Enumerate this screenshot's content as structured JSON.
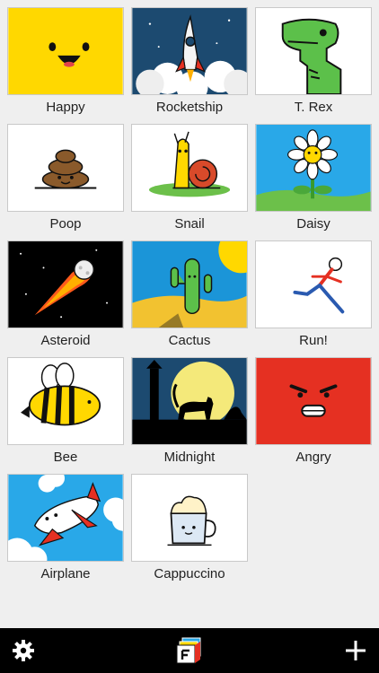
{
  "gallery": {
    "items": [
      {
        "label": "Happy",
        "bg": "#ffd800"
      },
      {
        "label": "Rocketship",
        "bg": "#1c4a70"
      },
      {
        "label": "T. Rex",
        "bg": "#ffffff"
      },
      {
        "label": "Poop",
        "bg": "#ffffff"
      },
      {
        "label": "Snail",
        "bg": "#ffffff"
      },
      {
        "label": "Daisy",
        "bg": "#29a8e8"
      },
      {
        "label": "Asteroid",
        "bg": "#000000"
      },
      {
        "label": "Cactus",
        "bg": "#1b95d8"
      },
      {
        "label": "Run!",
        "bg": "#ffffff"
      },
      {
        "label": "Bee",
        "bg": "#ffffff"
      },
      {
        "label": "Midnight",
        "bg": "#1c4a70"
      },
      {
        "label": "Angry",
        "bg": "#e53022"
      },
      {
        "label": "Airplane",
        "bg": "#29a8e8"
      },
      {
        "label": "Cappuccino",
        "bg": "#ffffff"
      }
    ]
  },
  "toolbar": {
    "settings_icon": "gear-icon",
    "logo": "app-logo-icon",
    "add_icon": "plus-icon",
    "background": "#000000"
  }
}
